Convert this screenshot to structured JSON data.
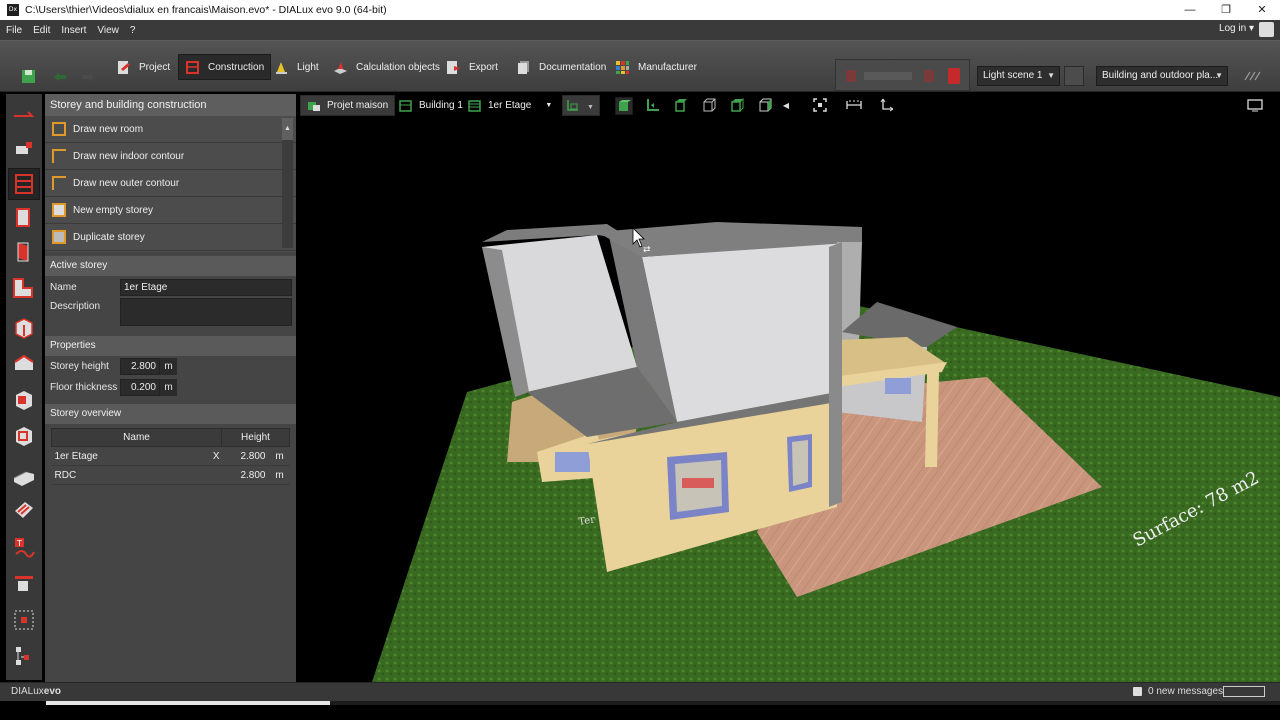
{
  "window": {
    "title": "C:\\Users\\thier\\Videos\\dialux en francais\\Maison.evo* - DIALux evo 9.0  (64-bit)",
    "app_icon_text": "Dx"
  },
  "menu": {
    "items": [
      "File",
      "Edit",
      "Insert",
      "View",
      "?"
    ],
    "login": "Log in"
  },
  "toolbar": {
    "tabs": [
      {
        "label": "Project",
        "icon": "project-icon"
      },
      {
        "label": "Construction",
        "icon": "construction-icon"
      },
      {
        "label": "Light",
        "icon": "light-icon"
      },
      {
        "label": "Calculation objects",
        "icon": "calculation-objects-icon"
      },
      {
        "label": "Export",
        "icon": "export-icon"
      },
      {
        "label": "Documentation",
        "icon": "documentation-icon"
      },
      {
        "label": "Manufacturer",
        "icon": "manufacturer-icon"
      }
    ],
    "active_tab": "Construction",
    "light_scene": "Light scene 1",
    "view_mode": "Building and outdoor pla..."
  },
  "panel": {
    "title": "Storey and building construction",
    "commands": [
      "Draw new room",
      "Draw new indoor contour",
      "Draw new outer contour",
      "New empty storey",
      "Duplicate storey"
    ],
    "active_storey": {
      "header": "Active storey",
      "name_label": "Name",
      "name_value": "1er Etage",
      "description_label": "Description",
      "description_value": ""
    },
    "properties": {
      "header": "Properties",
      "storey_height_label": "Storey height",
      "storey_height_value": "2.800",
      "floor_thickness_label": "Floor thickness",
      "floor_thickness_value": "0.200",
      "unit": "m"
    },
    "overview": {
      "header": "Storey overview",
      "col_name": "Name",
      "col_height": "Height",
      "rows": [
        {
          "name": "1er Etage",
          "marker": "X",
          "height": "2.800",
          "unit": "m"
        },
        {
          "name": "RDC",
          "marker": "",
          "height": "2.800",
          "unit": "m"
        }
      ]
    }
  },
  "viewport": {
    "breadcrumb": [
      "Projet maison",
      "Building 1",
      "1er Etage"
    ],
    "surface_label": "Surface: 78 m2",
    "terrace_label": "Ter"
  },
  "status": {
    "brand_prefix": "DIALux",
    "brand_suffix": "evo",
    "messages": "0 new messages"
  },
  "colors": {
    "accent_orange": "#e09a2a",
    "construction_red": "#d9342b",
    "wall_yellow": "#e9d39a",
    "grass": "#3d6b25"
  }
}
